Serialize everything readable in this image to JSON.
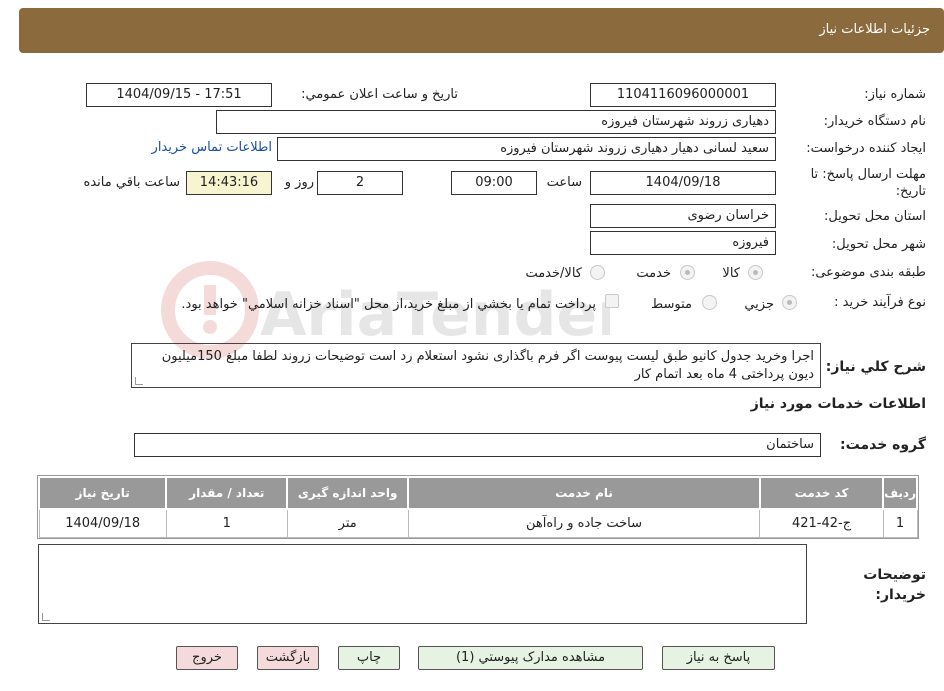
{
  "header": {
    "title": "جزئیات اطلاعات نیاز"
  },
  "form": {
    "need_number_label": "شماره نیاز:",
    "need_number": "1104116096000001",
    "announce_label": "تاریخ و ساعت اعلان عمومي:",
    "announce_value": "1404/09/15 - 17:51",
    "buyer_org_label": "نام دستگاه خريدار:",
    "buyer_org": "دهیاری زروند  شهرستان فیروزه",
    "requester_label": "ايجاد کننده درخواست:",
    "requester": "سعید لسانی دهیار دهیاری زروند  شهرستان فیروزه",
    "contact_link": "اطلاعات تماس خريدار",
    "deadline_label": "مهلت ارسال پاسخ: تا تاريخ:",
    "deadline_date": "1404/09/18",
    "time_label": "ساعت",
    "deadline_time": "09:00",
    "days": "2",
    "days_label": "روز و",
    "remaining_time": "14:43:16",
    "remaining_label": "ساعت باقي مانده",
    "province_label": "استان محل تحويل:",
    "province": "خراسان رضوی",
    "city_label": "شهر محل تحويل:",
    "city": "فیروزه",
    "category_label": "طبقه بندی موضوعی:",
    "category_options": [
      "کالا",
      "خدمت",
      "کالا/خدمت"
    ],
    "process_label": "نوع فرآيند خريد :",
    "process_options": [
      "جزيي",
      "متوسط"
    ],
    "payment_note": "پرداخت تمام يا بخشي از مبلغ خريد،از محل \"اسناد خزانه اسلامي\" خواهد بود."
  },
  "general_description": {
    "label": "شرح كلي نياز:",
    "text": "اجرا وخرید جدول کانیو طبق لیست پیوست اگر فرم باگذاری نشود استعلام رد است توضیحات زروند لطفا مبلغ 150میلیون دیون پرداختی 4 ماه بعد اتمام کار"
  },
  "services_section": {
    "title": "اطلاعات خدمات مورد نياز",
    "group_label": "گروه خدمت:",
    "group_value": "ساختمان"
  },
  "table": {
    "headers": [
      "رديف",
      "كد خدمت",
      "نام خدمت",
      "واحد اندازه گيری",
      "تعداد / مقدار",
      "تاريخ نياز"
    ],
    "rows": [
      [
        "1",
        "ج-42-421",
        "ساخت جاده و راه‌آهن",
        "متر",
        "1",
        "1404/09/18"
      ]
    ]
  },
  "buyer_notes": {
    "label": "توضيحات خريدار:",
    "text": ""
  },
  "buttons": {
    "reply": "پاسخ به نياز",
    "attachments": "مشاهده مدارک پيوستي (1)",
    "print": "چاپ",
    "back": "بازگشت",
    "exit": "خروج"
  },
  "watermark": "AriaTender.neT",
  "colors": {
    "header_bg": "#8b6a3e",
    "table_header_bg": "#999999",
    "link": "#1a4fa0"
  }
}
